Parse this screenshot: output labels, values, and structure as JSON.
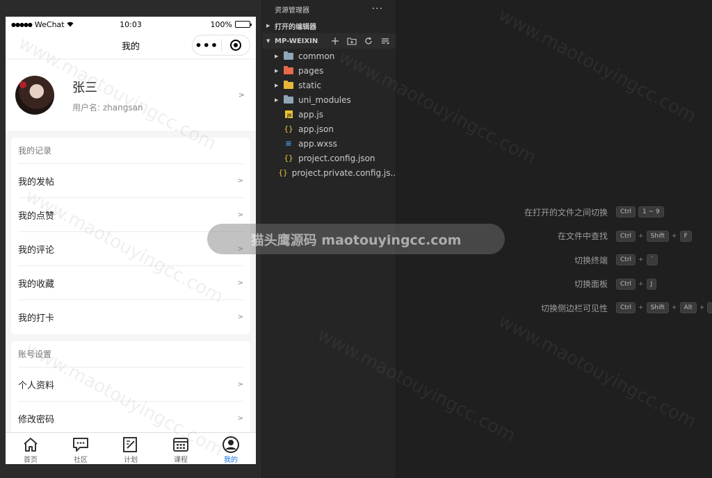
{
  "phone": {
    "status": {
      "signal": "●●●●●",
      "carrier": "WeChat",
      "wifi_icon": "wifi-icon",
      "time": "10:03",
      "battery": "100%",
      "battery_level": 1.0
    },
    "navbar": {
      "title": "我的",
      "more": "•••"
    },
    "profile": {
      "name": "张三",
      "username": "用户名: zhangsan",
      "arrow": ">"
    },
    "records": {
      "title": "我的记录",
      "items": [
        {
          "label": "我的发帖",
          "arrow": ">"
        },
        {
          "label": "我的点赞",
          "arrow": ">"
        },
        {
          "label": "我的评论",
          "arrow": ">"
        },
        {
          "label": "我的收藏",
          "arrow": ">"
        },
        {
          "label": "我的打卡",
          "arrow": ">"
        }
      ]
    },
    "account": {
      "title": "账号设置",
      "items": [
        {
          "label": "个人资料",
          "arrow": ">"
        },
        {
          "label": "修改密码",
          "arrow": ">"
        }
      ]
    },
    "tabbar": [
      {
        "label": "首页",
        "icon": "home-icon"
      },
      {
        "label": "社区",
        "icon": "chat-icon"
      },
      {
        "label": "计划",
        "icon": "edit-icon"
      },
      {
        "label": "课程",
        "icon": "calendar-icon"
      },
      {
        "label": "我的",
        "icon": "user-icon",
        "active": true
      }
    ],
    "accent": "#1a73e8"
  },
  "explorer": {
    "title": "资源管理器",
    "menu": "···",
    "open_editors": "打开的编辑器",
    "project": "MP-WEIXIN",
    "tree": [
      {
        "name": "common",
        "type": "folder",
        "color": "#8fa6b8"
      },
      {
        "name": "pages",
        "type": "folder",
        "color": "#e56a4a"
      },
      {
        "name": "static",
        "type": "folder",
        "color": "#e8b73a"
      },
      {
        "name": "uni_modules",
        "type": "folder",
        "color": "#8fa6b8"
      },
      {
        "name": "app.js",
        "type": "js"
      },
      {
        "name": "app.json",
        "type": "json"
      },
      {
        "name": "app.wxss",
        "type": "css"
      },
      {
        "name": "project.config.json",
        "type": "json"
      },
      {
        "name": "project.private.config.js...",
        "type": "json"
      }
    ]
  },
  "shortcuts": [
    {
      "label": "在打开的文件之间切换",
      "keys": [
        "Ctrl",
        "1 ~ 9"
      ],
      "separator": ""
    },
    {
      "label": "在文件中查找",
      "keys": [
        "Ctrl",
        "Shift",
        "F"
      ],
      "separator": "+"
    },
    {
      "label": "切换终端",
      "keys": [
        "Ctrl",
        "`"
      ],
      "separator": "+"
    },
    {
      "label": "切换面板",
      "keys": [
        "Ctrl",
        "J"
      ],
      "separator": "+"
    },
    {
      "label": "切换侧边栏可见性",
      "keys": [
        "Ctrl",
        "Shift",
        "Alt",
        "B"
      ],
      "separator": "+"
    }
  ],
  "watermark": {
    "band": "猫头鹰源码 maotouyingcc.com",
    "text": "www.maotouyingcc.com"
  }
}
